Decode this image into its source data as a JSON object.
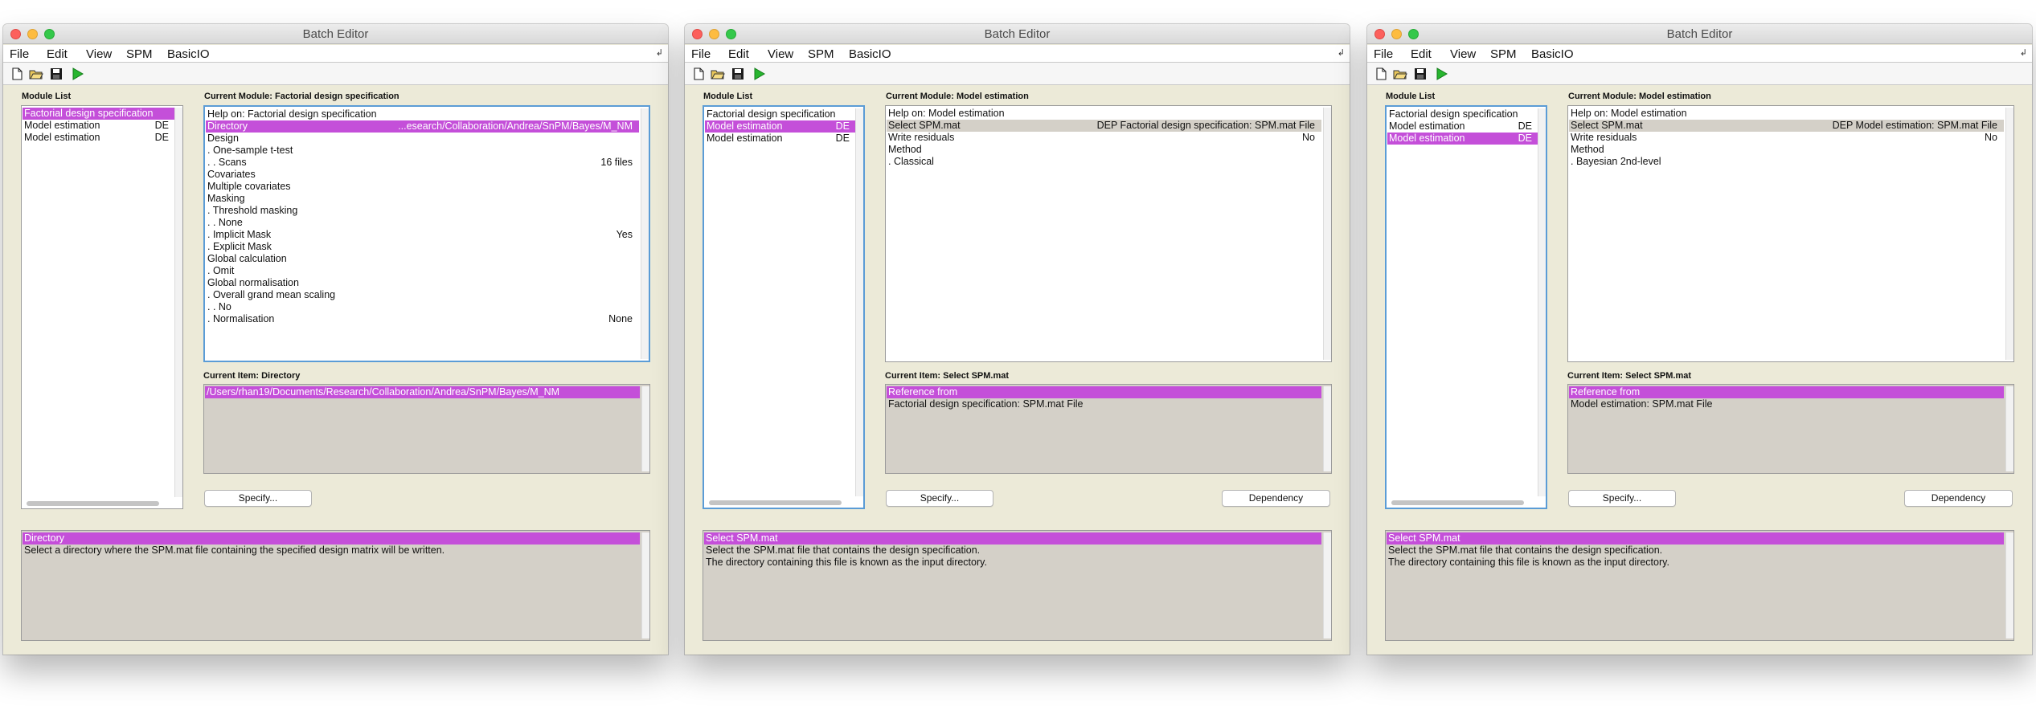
{
  "windows": [
    {
      "title": "Batch Editor",
      "menu": [
        "File",
        "Edit",
        "View",
        "SPM",
        "BasicIO"
      ],
      "module_list_label": "Module List",
      "modules": [
        {
          "name": "Factorial design specification",
          "tag": ""
        },
        {
          "name": "Model estimation",
          "tag": "DE"
        },
        {
          "name": "Model estimation",
          "tag": "DE"
        }
      ],
      "current_module_label": "Current Module: Factorial design specification",
      "module_rows": [
        {
          "label": "Help on: Factorial design specification",
          "value": ""
        },
        {
          "label": "Directory",
          "value": "...esearch/Collaboration/Andrea/SnPM/Bayes/M_NM"
        },
        {
          "label": "Design",
          "value": ""
        },
        {
          "label": ". One-sample t-test",
          "value": ""
        },
        {
          "label": ". . Scans",
          "value": "16 files"
        },
        {
          "label": "Covariates",
          "value": ""
        },
        {
          "label": "Multiple covariates",
          "value": ""
        },
        {
          "label": "Masking",
          "value": ""
        },
        {
          "label": ". Threshold masking",
          "value": ""
        },
        {
          "label": ". . None",
          "value": ""
        },
        {
          "label": ". Implicit Mask",
          "value": "Yes"
        },
        {
          "label": ". Explicit Mask",
          "value": ""
        },
        {
          "label": "Global calculation",
          "value": ""
        },
        {
          "label": ". Omit",
          "value": ""
        },
        {
          "label": "Global normalisation",
          "value": ""
        },
        {
          "label": ". Overall grand mean scaling",
          "value": ""
        },
        {
          "label": ". . No",
          "value": ""
        },
        {
          "label": ". Normalisation",
          "value": "None"
        }
      ],
      "current_item_label": "Current Item: Directory",
      "item_rows": [
        "/Users/rhan19/Documents/Research/Collaboration/Andrea/SnPM/Bayes/M_NM"
      ],
      "specify_label": "Specify...",
      "dependency_label": "",
      "help_rows": [
        "Directory",
        "Select a directory where the SPM.mat file containing the specified design matrix will be written."
      ]
    },
    {
      "title": "Batch Editor",
      "menu": [
        "File",
        "Edit",
        "View",
        "SPM",
        "BasicIO"
      ],
      "module_list_label": "Module List",
      "modules": [
        {
          "name": "Factorial design specification",
          "tag": ""
        },
        {
          "name": "Model estimation",
          "tag": "DE"
        },
        {
          "name": "Model estimation",
          "tag": "DE"
        }
      ],
      "current_module_label": "Current Module: Model estimation",
      "module_rows": [
        {
          "label": "Help on: Model estimation",
          "value": ""
        },
        {
          "label": "Select SPM.mat",
          "value": "DEP Factorial design specification: SPM.mat File"
        },
        {
          "label": "Write residuals",
          "value": "No"
        },
        {
          "label": "Method",
          "value": ""
        },
        {
          "label": ". Classical",
          "value": ""
        }
      ],
      "current_item_label": "Current Item: Select SPM.mat",
      "item_rows": [
        "Reference from",
        "Factorial design specification: SPM.mat File"
      ],
      "specify_label": "Specify...",
      "dependency_label": "Dependency",
      "help_rows": [
        "Select SPM.mat",
        "Select the SPM.mat file that contains the design specification.",
        "The directory containing this file is known as the input directory."
      ]
    },
    {
      "title": "Batch Editor",
      "menu": [
        "File",
        "Edit",
        "View",
        "SPM",
        "BasicIO"
      ],
      "module_list_label": "Module List",
      "modules": [
        {
          "name": "Factorial design specification",
          "tag": ""
        },
        {
          "name": "Model estimation",
          "tag": "DE"
        },
        {
          "name": "Model estimation",
          "tag": "DE"
        }
      ],
      "current_module_label": "Current Module: Model estimation",
      "module_rows": [
        {
          "label": "Help on: Model estimation",
          "value": ""
        },
        {
          "label": "Select SPM.mat",
          "value": "DEP Model estimation: SPM.mat File"
        },
        {
          "label": "Write residuals",
          "value": "No"
        },
        {
          "label": "Method",
          "value": ""
        },
        {
          "label": ". Bayesian 2nd-level",
          "value": ""
        }
      ],
      "current_item_label": "Current Item: Select SPM.mat",
      "item_rows": [
        "Reference from",
        "Model estimation: SPM.mat File"
      ],
      "specify_label": "Specify...",
      "dependency_label": "Dependency",
      "help_rows": [
        "Select SPM.mat",
        "Select the SPM.mat file that contains the design specification.",
        "The directory containing this file is known as the input directory."
      ]
    }
  ],
  "colors": {
    "selection": "#c44fd9",
    "gray_selection": "#d4d0c8",
    "window_bg": "#ecead8",
    "focus_border": "#5b9cd6"
  },
  "icons": [
    "new-file-icon",
    "open-folder-icon",
    "save-icon",
    "run-icon",
    "close-icon",
    "minimize-icon",
    "zoom-icon"
  ]
}
